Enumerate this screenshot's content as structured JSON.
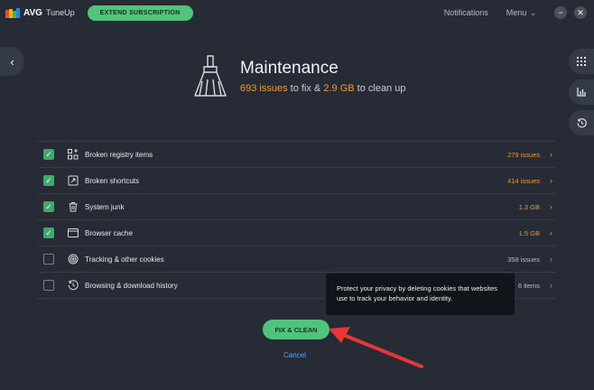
{
  "app": {
    "brand": "AVG",
    "product": "TuneUp",
    "extend_button": "EXTEND SUBSCRIPTION",
    "notifications": "Notifications",
    "menu": "Menu"
  },
  "header": {
    "title": "Maintenance",
    "issues_value": "693 issues",
    "to_fix": " to fix & ",
    "size_value": "2.9 GB",
    "to_clean": " to clean up"
  },
  "items": [
    {
      "label": "Broken registry items",
      "value": "279 issues",
      "checked": true,
      "icon": "registry-icon"
    },
    {
      "label": "Broken shortcuts",
      "value": "414 issues",
      "checked": true,
      "icon": "shortcut-icon"
    },
    {
      "label": "System junk",
      "value": "1.3 GB",
      "checked": true,
      "icon": "trash-icon"
    },
    {
      "label": "Browser cache",
      "value": "1.5 GB",
      "checked": true,
      "icon": "browser-icon"
    },
    {
      "label": "Tracking & other cookies",
      "value": "358 issues",
      "checked": false,
      "icon": "fingerprint-icon"
    },
    {
      "label": "Browsing & download history",
      "value": "6 items",
      "checked": false,
      "icon": "history-icon"
    }
  ],
  "tooltip": {
    "text": "Protect your privacy by deleting cookies that websites use to track your behavior and identity."
  },
  "actions": {
    "fix_clean": "FIX & CLEAN",
    "cancel": "Cancel"
  },
  "colors": {
    "accent_green": "#4fc47a",
    "warning_orange": "#f39a2d",
    "link_blue": "#58a4ff",
    "annotation_red": "#e53935"
  }
}
